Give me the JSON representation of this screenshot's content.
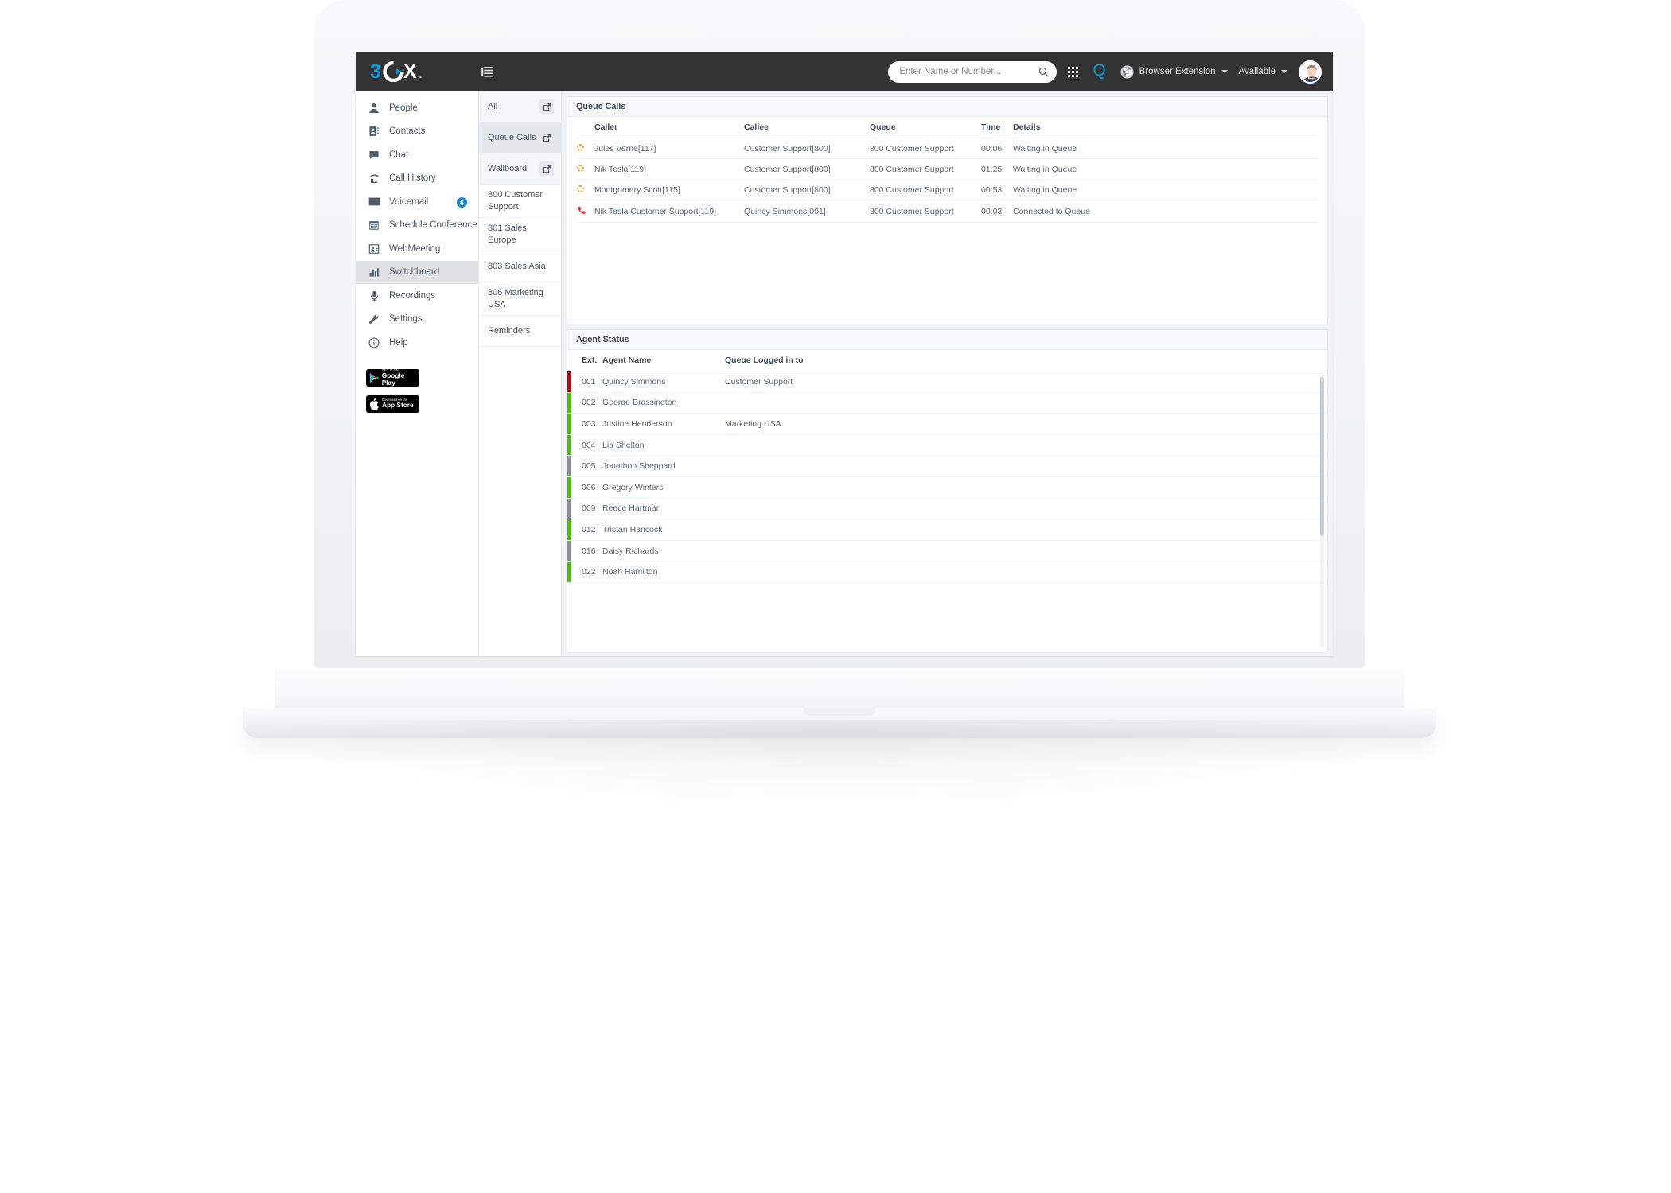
{
  "brand": {
    "logo_text": "3CX",
    "accent": "#00a0e3",
    "topbar_bg": "#333333"
  },
  "topbar": {
    "menu_icon": "hamburger-menu-icon",
    "search": {
      "placeholder": "Enter Name or Number...",
      "value": "",
      "icon": "search-icon"
    },
    "apps_icon": "grid-apps-icon",
    "q_icon": "Q",
    "browser_extension": {
      "label": "Browser Extension",
      "icon": "chrome-icon"
    },
    "presence": {
      "label": "Available"
    },
    "avatar": "user-avatar"
  },
  "sidebar": {
    "items": [
      {
        "label": "People",
        "icon": "person-icon",
        "badge": "",
        "active": false
      },
      {
        "label": "Contacts",
        "icon": "contact-book-icon",
        "badge": "",
        "active": false
      },
      {
        "label": "Chat",
        "icon": "chat-bubble-icon",
        "badge": "",
        "active": false
      },
      {
        "label": "Call History",
        "icon": "telephone-icon",
        "badge": "",
        "active": false
      },
      {
        "label": "Voicemail",
        "icon": "envelope-icon",
        "badge": "6",
        "active": false
      },
      {
        "label": "Schedule Conference",
        "icon": "calendar-icon",
        "badge": "",
        "active": false
      },
      {
        "label": "WebMeeting",
        "icon": "webmeeting-icon",
        "badge": "",
        "active": false
      },
      {
        "label": "Switchboard",
        "icon": "bar-chart-icon",
        "badge": "",
        "active": true
      },
      {
        "label": "Recordings",
        "icon": "microphone-icon",
        "badge": "",
        "active": false
      },
      {
        "label": "Settings",
        "icon": "wrench-icon",
        "badge": "",
        "active": false
      },
      {
        "label": "Help",
        "icon": "info-circle-icon",
        "badge": "",
        "active": false
      }
    ],
    "stores": [
      {
        "small": "GET IT ON",
        "big": "Google Play",
        "icon": "google-play-icon"
      },
      {
        "small": "Download on the",
        "big": "App Store",
        "icon": "apple-icon"
      }
    ]
  },
  "queue_nav": {
    "items": [
      {
        "label": "All",
        "external": true,
        "boxed": true,
        "state": "tint"
      },
      {
        "label": "Queue Calls",
        "external": true,
        "boxed": false,
        "state": "sel"
      },
      {
        "label": "Wallboard",
        "external": true,
        "boxed": true,
        "state": "tint"
      },
      {
        "label": "800 Customer Support",
        "external": false,
        "boxed": false,
        "state": ""
      },
      {
        "label": "801 Sales Europe",
        "external": false,
        "boxed": false,
        "state": ""
      },
      {
        "label": "803 Sales Asia",
        "external": false,
        "boxed": false,
        "state": ""
      },
      {
        "label": "806 Marketing USA",
        "external": false,
        "boxed": false,
        "state": ""
      },
      {
        "label": "Reminders",
        "external": false,
        "boxed": false,
        "state": ""
      }
    ]
  },
  "queue_calls": {
    "title": "Queue Calls",
    "columns": [
      "",
      "Caller",
      "Callee",
      "Queue",
      "Time",
      "Details"
    ],
    "rows": [
      {
        "icon": "spinner-waiting-icon",
        "caller": "Jules Verne[117]",
        "callee": "Customer Support[800]",
        "queue": "800 Customer Support",
        "time": "00:06",
        "details": "Waiting in Queue"
      },
      {
        "icon": "spinner-waiting-icon",
        "caller": "Nik Tesla[119]",
        "callee": "Customer Support[800]",
        "queue": "800 Customer Support",
        "time": "01:25",
        "details": "Waiting in Queue"
      },
      {
        "icon": "spinner-waiting-icon",
        "caller": "Montgomery Scott[115]",
        "callee": "Customer Support[800]",
        "queue": "800 Customer Support",
        "time": "00:53",
        "details": "Waiting in Queue"
      },
      {
        "icon": "phone-connected-icon",
        "caller": "Nik Tesla:Customer Support[119]",
        "callee": "Quincy Simmons[001]",
        "queue": "800 Customer Support",
        "time": "00:03",
        "details": "Connected to Queue"
      }
    ]
  },
  "agent_status": {
    "title": "Agent Status",
    "columns": [
      "Ext.",
      "Agent Name",
      "Queue Logged in to"
    ],
    "status_colors": {
      "busy": "#cc0000",
      "available": "#3cc800",
      "offline": "#8a8f94"
    },
    "rows": [
      {
        "ext": "001",
        "name": "Quincy Simmons",
        "queue": "Customer Support",
        "status": "busy"
      },
      {
        "ext": "002",
        "name": "George Brassington",
        "queue": "",
        "status": "available"
      },
      {
        "ext": "003",
        "name": "Justine Henderson",
        "queue": "Marketing USA",
        "status": "available"
      },
      {
        "ext": "004",
        "name": "Lia Shelton",
        "queue": "",
        "status": "available"
      },
      {
        "ext": "005",
        "name": "Jonathon Sheppard",
        "queue": "",
        "status": "offline"
      },
      {
        "ext": "006",
        "name": "Gregory Winters",
        "queue": "",
        "status": "available"
      },
      {
        "ext": "009",
        "name": "Reece Hartman",
        "queue": "",
        "status": "offline"
      },
      {
        "ext": "012",
        "name": "Tristan Hancock",
        "queue": "",
        "status": "available"
      },
      {
        "ext": "016",
        "name": "Daisy Richards",
        "queue": "",
        "status": "offline"
      },
      {
        "ext": "022",
        "name": "Noah Hamilton",
        "queue": "",
        "status": "available"
      }
    ]
  }
}
